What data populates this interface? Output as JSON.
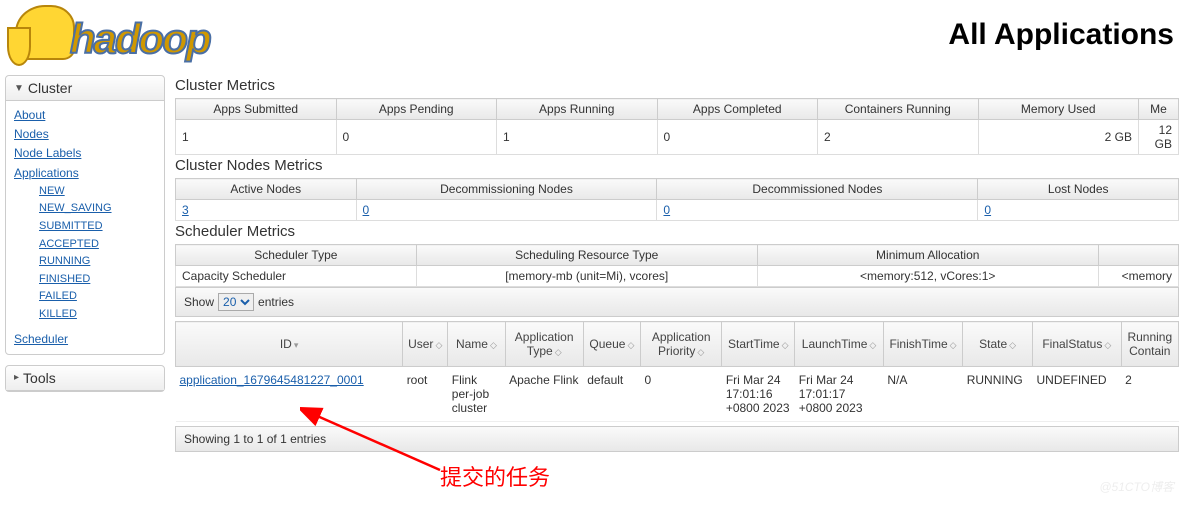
{
  "header": {
    "page_title": "All Applications",
    "logo_text": "hadoop"
  },
  "sidebar": {
    "cluster": {
      "title": "Cluster",
      "links": [
        "About",
        "Nodes",
        "Node Labels",
        "Applications"
      ],
      "app_states": [
        "NEW",
        "NEW_SAVING",
        "SUBMITTED",
        "ACCEPTED",
        "RUNNING",
        "FINISHED",
        "FAILED",
        "KILLED"
      ],
      "scheduler": "Scheduler"
    },
    "tools": {
      "title": "Tools"
    }
  },
  "cluster_metrics": {
    "title": "Cluster Metrics",
    "headers": [
      "Apps Submitted",
      "Apps Pending",
      "Apps Running",
      "Apps Completed",
      "Containers Running",
      "Memory Used",
      "Me"
    ],
    "row": [
      "1",
      "0",
      "1",
      "0",
      "2",
      "2 GB",
      "12 GB"
    ]
  },
  "node_metrics": {
    "title": "Cluster Nodes Metrics",
    "headers": [
      "Active Nodes",
      "Decommissioning Nodes",
      "Decommissioned Nodes",
      "Lost Nodes"
    ],
    "row": [
      "3",
      "0",
      "0",
      "0"
    ]
  },
  "scheduler_metrics": {
    "title": "Scheduler Metrics",
    "headers": [
      "Scheduler Type",
      "Scheduling Resource Type",
      "Minimum Allocation",
      ""
    ],
    "row": [
      "Capacity Scheduler",
      "[memory-mb (unit=Mi), vcores]",
      "<memory:512, vCores:1>",
      "<memory"
    ]
  },
  "entries": {
    "show": "Show",
    "count": "20",
    "suffix": "entries"
  },
  "apps": {
    "headers": [
      "ID",
      "User",
      "Name",
      "Application Type",
      "Queue",
      "Application Priority",
      "StartTime",
      "LaunchTime",
      "FinishTime",
      "State",
      "FinalStatus",
      "Running Contain"
    ],
    "rows": [
      {
        "id": "application_1679645481227_0001",
        "user": "root",
        "name": "Flink per-job cluster",
        "apptype": "Apache Flink",
        "queue": "default",
        "priority": "0",
        "start": "Fri Mar 24 17:01:16 +0800 2023",
        "launch": "Fri Mar 24 17:01:17 +0800 2023",
        "finish": "N/A",
        "state": "RUNNING",
        "final": "UNDEFINED",
        "containers": "2"
      }
    ]
  },
  "footer": "Showing 1 to 1 of 1 entries",
  "annotation": "提交的任务",
  "watermark": "@51CTO博客"
}
